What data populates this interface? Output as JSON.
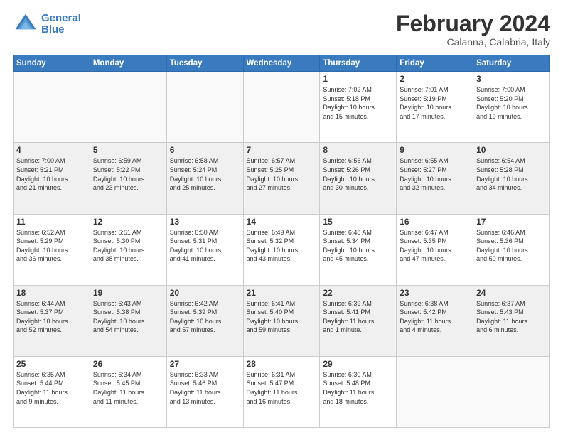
{
  "header": {
    "logo_line1": "General",
    "logo_line2": "Blue",
    "main_title": "February 2024",
    "subtitle": "Calanna, Calabria, Italy"
  },
  "days_of_week": [
    "Sunday",
    "Monday",
    "Tuesday",
    "Wednesday",
    "Thursday",
    "Friday",
    "Saturday"
  ],
  "weeks": [
    [
      {
        "day": "",
        "info": "",
        "empty": true
      },
      {
        "day": "",
        "info": "",
        "empty": true
      },
      {
        "day": "",
        "info": "",
        "empty": true
      },
      {
        "day": "",
        "info": "",
        "empty": true
      },
      {
        "day": "1",
        "info": "Sunrise: 7:02 AM\nSunset: 5:18 PM\nDaylight: 10 hours\nand 15 minutes.",
        "empty": false
      },
      {
        "day": "2",
        "info": "Sunrise: 7:01 AM\nSunset: 5:19 PM\nDaylight: 10 hours\nand 17 minutes.",
        "empty": false
      },
      {
        "day": "3",
        "info": "Sunrise: 7:00 AM\nSunset: 5:20 PM\nDaylight: 10 hours\nand 19 minutes.",
        "empty": false
      }
    ],
    [
      {
        "day": "4",
        "info": "Sunrise: 7:00 AM\nSunset: 5:21 PM\nDaylight: 10 hours\nand 21 minutes.",
        "empty": false
      },
      {
        "day": "5",
        "info": "Sunrise: 6:59 AM\nSunset: 5:22 PM\nDaylight: 10 hours\nand 23 minutes.",
        "empty": false
      },
      {
        "day": "6",
        "info": "Sunrise: 6:58 AM\nSunset: 5:24 PM\nDaylight: 10 hours\nand 25 minutes.",
        "empty": false
      },
      {
        "day": "7",
        "info": "Sunrise: 6:57 AM\nSunset: 5:25 PM\nDaylight: 10 hours\nand 27 minutes.",
        "empty": false
      },
      {
        "day": "8",
        "info": "Sunrise: 6:56 AM\nSunset: 5:26 PM\nDaylight: 10 hours\nand 30 minutes.",
        "empty": false
      },
      {
        "day": "9",
        "info": "Sunrise: 6:55 AM\nSunset: 5:27 PM\nDaylight: 10 hours\nand 32 minutes.",
        "empty": false
      },
      {
        "day": "10",
        "info": "Sunrise: 6:54 AM\nSunset: 5:28 PM\nDaylight: 10 hours\nand 34 minutes.",
        "empty": false
      }
    ],
    [
      {
        "day": "11",
        "info": "Sunrise: 6:52 AM\nSunset: 5:29 PM\nDaylight: 10 hours\nand 36 minutes.",
        "empty": false
      },
      {
        "day": "12",
        "info": "Sunrise: 6:51 AM\nSunset: 5:30 PM\nDaylight: 10 hours\nand 38 minutes.",
        "empty": false
      },
      {
        "day": "13",
        "info": "Sunrise: 6:50 AM\nSunset: 5:31 PM\nDaylight: 10 hours\nand 41 minutes.",
        "empty": false
      },
      {
        "day": "14",
        "info": "Sunrise: 6:49 AM\nSunset: 5:32 PM\nDaylight: 10 hours\nand 43 minutes.",
        "empty": false
      },
      {
        "day": "15",
        "info": "Sunrise: 6:48 AM\nSunset: 5:34 PM\nDaylight: 10 hours\nand 45 minutes.",
        "empty": false
      },
      {
        "day": "16",
        "info": "Sunrise: 6:47 AM\nSunset: 5:35 PM\nDaylight: 10 hours\nand 47 minutes.",
        "empty": false
      },
      {
        "day": "17",
        "info": "Sunrise: 6:46 AM\nSunset: 5:36 PM\nDaylight: 10 hours\nand 50 minutes.",
        "empty": false
      }
    ],
    [
      {
        "day": "18",
        "info": "Sunrise: 6:44 AM\nSunset: 5:37 PM\nDaylight: 10 hours\nand 52 minutes.",
        "empty": false
      },
      {
        "day": "19",
        "info": "Sunrise: 6:43 AM\nSunset: 5:38 PM\nDaylight: 10 hours\nand 54 minutes.",
        "empty": false
      },
      {
        "day": "20",
        "info": "Sunrise: 6:42 AM\nSunset: 5:39 PM\nDaylight: 10 hours\nand 57 minutes.",
        "empty": false
      },
      {
        "day": "21",
        "info": "Sunrise: 6:41 AM\nSunset: 5:40 PM\nDaylight: 10 hours\nand 59 minutes.",
        "empty": false
      },
      {
        "day": "22",
        "info": "Sunrise: 6:39 AM\nSunset: 5:41 PM\nDaylight: 11 hours\nand 1 minute.",
        "empty": false
      },
      {
        "day": "23",
        "info": "Sunrise: 6:38 AM\nSunset: 5:42 PM\nDaylight: 11 hours\nand 4 minutes.",
        "empty": false
      },
      {
        "day": "24",
        "info": "Sunrise: 6:37 AM\nSunset: 5:43 PM\nDaylight: 11 hours\nand 6 minutes.",
        "empty": false
      }
    ],
    [
      {
        "day": "25",
        "info": "Sunrise: 6:35 AM\nSunset: 5:44 PM\nDaylight: 11 hours\nand 9 minutes.",
        "empty": false
      },
      {
        "day": "26",
        "info": "Sunrise: 6:34 AM\nSunset: 5:45 PM\nDaylight: 11 hours\nand 11 minutes.",
        "empty": false
      },
      {
        "day": "27",
        "info": "Sunrise: 6:33 AM\nSunset: 5:46 PM\nDaylight: 11 hours\nand 13 minutes.",
        "empty": false
      },
      {
        "day": "28",
        "info": "Sunrise: 6:31 AM\nSunset: 5:47 PM\nDaylight: 11 hours\nand 16 minutes.",
        "empty": false
      },
      {
        "day": "29",
        "info": "Sunrise: 6:30 AM\nSunset: 5:48 PM\nDaylight: 11 hours\nand 18 minutes.",
        "empty": false
      },
      {
        "day": "",
        "info": "",
        "empty": true
      },
      {
        "day": "",
        "info": "",
        "empty": true
      }
    ]
  ]
}
